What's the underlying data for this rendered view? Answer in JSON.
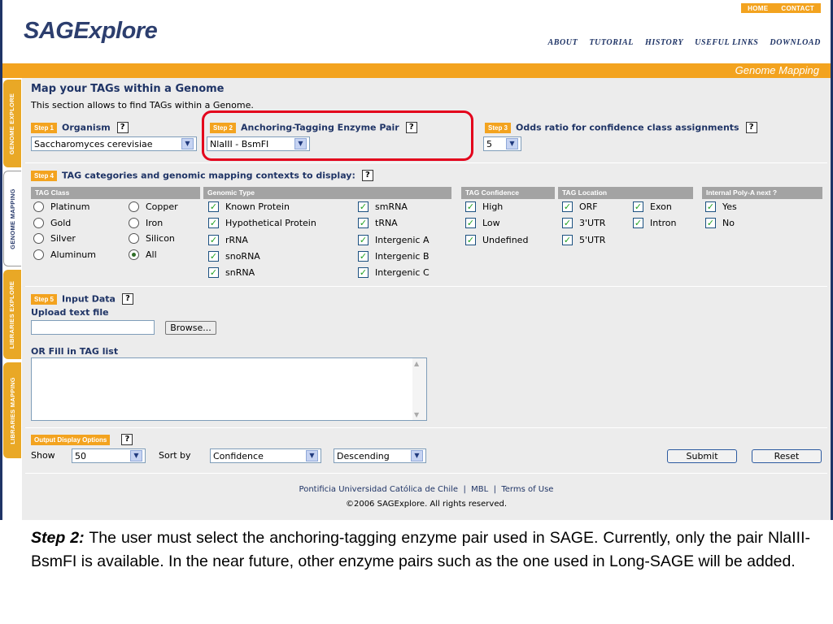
{
  "header": {
    "logo": "SAGExplore",
    "top_links": [
      "HOME",
      "CONTACT"
    ],
    "nav": [
      "ABOUT",
      "TUTORIAL",
      "HISTORY",
      "USEFUL LINKS",
      "DOWNLOAD"
    ],
    "section_banner": "Genome Mapping"
  },
  "side_tabs": [
    "GENOME EXPLORE",
    "GENOME MAPPING",
    "LIBRARIES EXPLORE",
    "LIBRARIES MAPPING"
  ],
  "main": {
    "title": "Map your TAGs within a Genome",
    "subtitle": "This section allows to find TAGs within a Genome.",
    "help": "?"
  },
  "step1": {
    "badge": "Step 1",
    "title": "Organism",
    "value": "Saccharomyces cerevisiae"
  },
  "step2": {
    "badge": "Step 2",
    "title": "Anchoring-Tagging Enzyme Pair",
    "value": "NlaIII - BsmFI"
  },
  "step3": {
    "badge": "Step 3",
    "title": "Odds ratio for confidence class assignments",
    "value": "5"
  },
  "step4": {
    "badge": "Step 4",
    "title": "TAG categories and genomic mapping contexts to display:",
    "headers": [
      "TAG Class",
      "Genomic Type",
      "TAG Confidence",
      "TAG Location",
      "Internal Poly-A next ?"
    ],
    "tag_class": [
      "Platinum",
      "Gold",
      "Silver",
      "Aluminum",
      "Copper",
      "Iron",
      "Silicon",
      "All"
    ],
    "genomic_type": [
      "Known Protein",
      "Hypothetical Protein",
      "rRNA",
      "snoRNA",
      "snRNA",
      "smRNA",
      "tRNA",
      "Intergenic A",
      "Intergenic B",
      "Intergenic C"
    ],
    "tag_confidence": [
      "High",
      "Low",
      "Undefined"
    ],
    "tag_location": [
      "ORF",
      "3'UTR",
      "5'UTR",
      "Exon",
      "Intron"
    ],
    "poly_a": [
      "Yes",
      "No"
    ]
  },
  "step5": {
    "badge": "Step 5",
    "title": "Input Data",
    "upload_label": "Upload text file",
    "browse": "Browse...",
    "fill_label": "OR Fill in TAG list"
  },
  "output": {
    "badge": "Output Display Options",
    "show_label": "Show",
    "show_value": "50",
    "sort_label": "Sort by",
    "sort_value": "Confidence",
    "order_value": "Descending",
    "submit": "Submit",
    "reset": "Reset"
  },
  "footer": {
    "links": [
      "Pontificia Universidad Católica de Chile",
      "MBL",
      "Terms of Use"
    ],
    "separator": "|",
    "copyright": "©2006 SAGExplore. All rights reserved."
  },
  "caption": {
    "lead": "Step 2:",
    "text": "The user must select the anchoring-tagging enzyme pair used in SAGE. Currently, only the pair NlaIII-BsmFI is available. In the near future, other enzyme pairs such as the one used in Long-SAGE will be added."
  },
  "colors": {
    "brand_navy": "#1f3466",
    "accent_orange": "#f3a31f",
    "highlight_red": "#e3001b"
  }
}
